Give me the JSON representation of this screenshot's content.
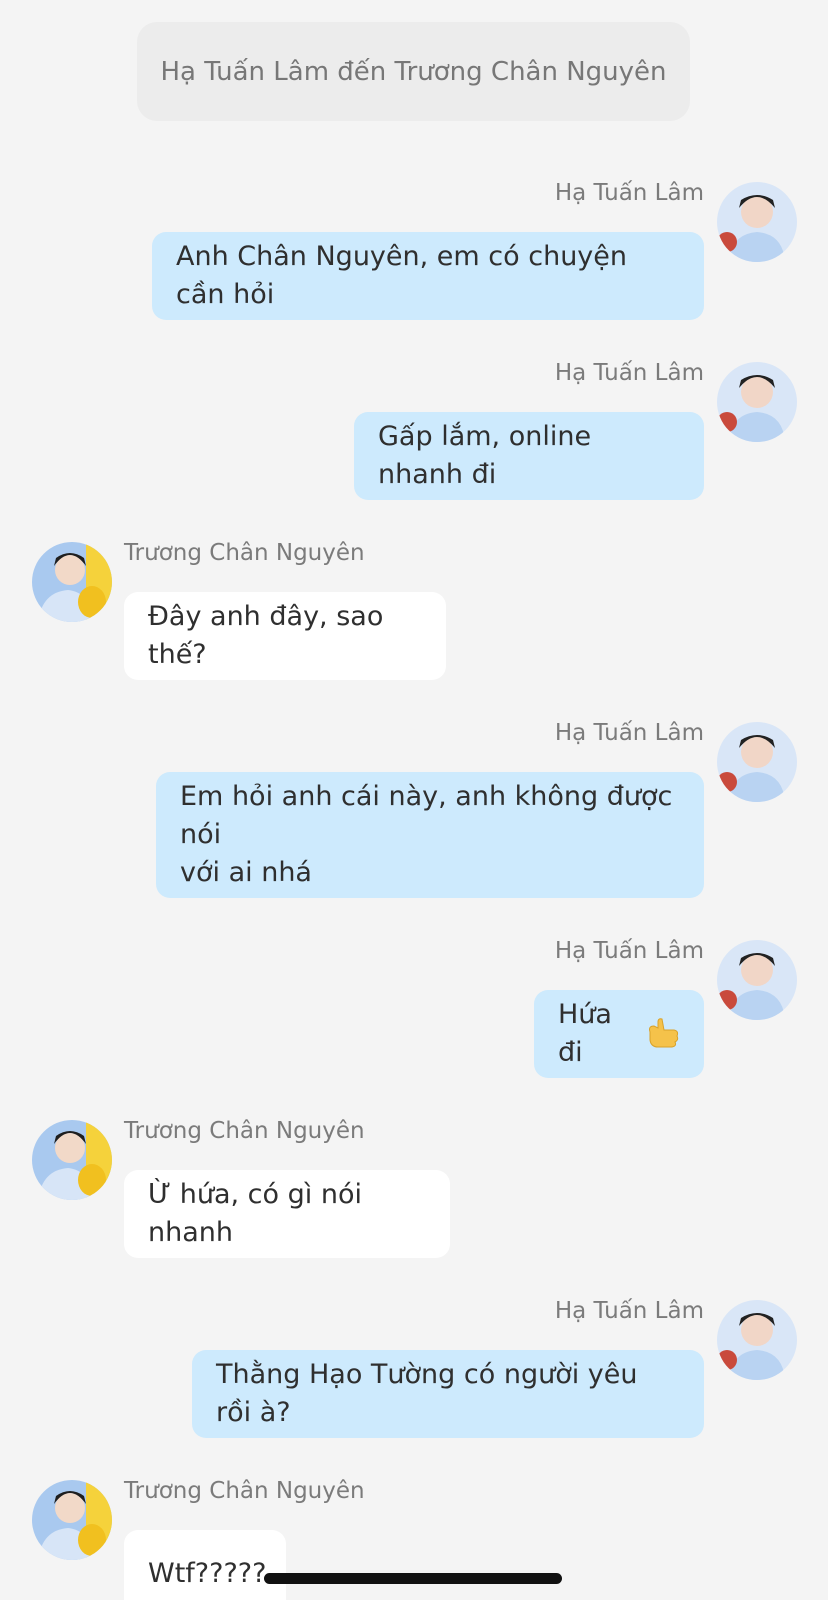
{
  "header": {
    "title": "Hạ Tuấn Lâm đến Trương Chân Nguyên"
  },
  "messages": [
    {
      "side": "right",
      "sender": "Hạ Tuấn Lâm",
      "text": "Anh Chân Nguyên, em có chuyện cần hỏi"
    },
    {
      "side": "right",
      "sender": "Hạ Tuấn Lâm",
      "text": "Gấp lắm, online nhanh đi"
    },
    {
      "side": "left",
      "sender": "Trương Chân Nguyên",
      "text": "Đây anh đây, sao thế?"
    },
    {
      "side": "right",
      "sender": "Hạ Tuấn Lâm",
      "text": "Em hỏi anh cái này, anh không được nói",
      "text2": "với ai nhá"
    },
    {
      "side": "right",
      "sender": "Hạ Tuấn Lâm",
      "text": "Hứa đi",
      "emoji": "call-me-hand-emoji"
    },
    {
      "side": "left",
      "sender": "Trương Chân Nguyên",
      "text": "Ừ hứa, có gì nói nhanh"
    },
    {
      "side": "right",
      "sender": "Hạ Tuấn Lâm",
      "text": "Thằng Hạo Tường có người yêu rồi à?"
    },
    {
      "side": "left",
      "sender": "Trương Chân Nguyên",
      "text": "Wtf?????"
    }
  ],
  "colors": {
    "sent_bubble": "#cdeafd",
    "received_bubble": "#ffffff",
    "background": "#f4f4f4"
  }
}
